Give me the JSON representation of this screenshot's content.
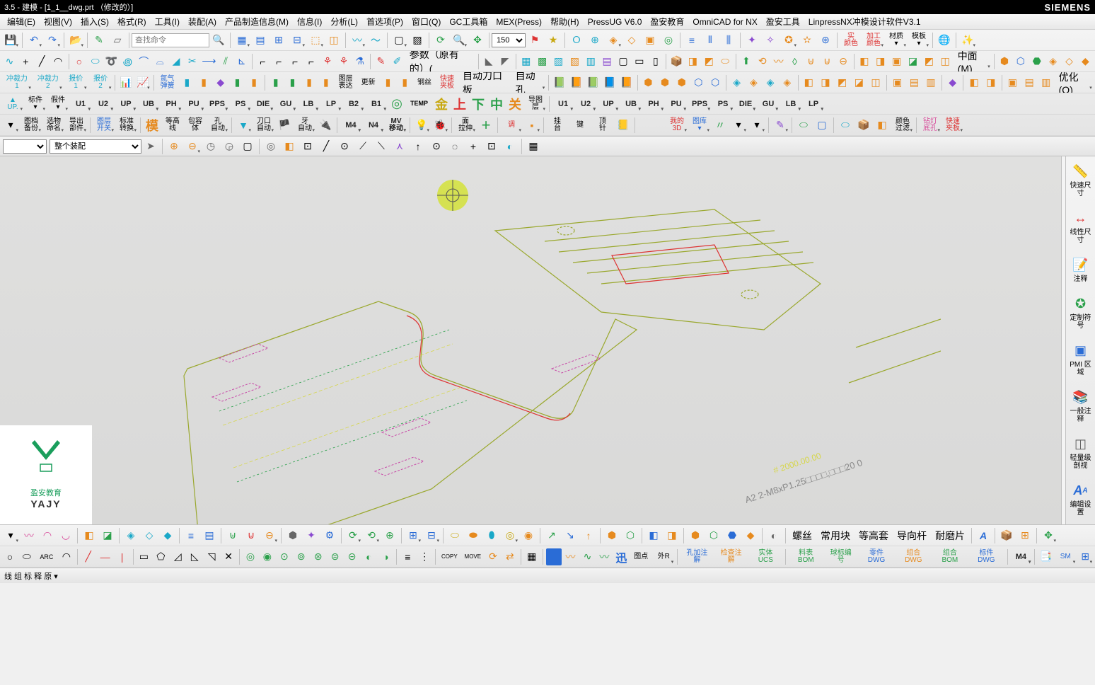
{
  "titlebar": {
    "left": "3.5 - 建模 - [1_1__dwg.prt （修改的）]",
    "right": "SIEMENS"
  },
  "menubar": [
    "编辑(E)",
    "视图(V)",
    "插入(S)",
    "格式(R)",
    "工具(I)",
    "装配(A)",
    "产品制造信息(M)",
    "信息(I)",
    "分析(L)",
    "首选项(P)",
    "窗口(Q)",
    "GC工具箱",
    "MEX(Press)",
    "帮助(H)",
    "PressUG V6.0",
    "盈安教育",
    "OmniCAD for NX",
    "盈安工具",
    "LinpressNX冲模设计软件V3.1"
  ],
  "row1": {
    "search_ph": "查找命令",
    "combo_val": "150"
  },
  "row2": {
    "param_label": "参数（原有的）(",
    "face_menu": "中面(M)"
  },
  "row3": {
    "u_items": [
      "U1",
      "U2",
      "UP",
      "UB",
      "PH",
      "PU",
      "PPS",
      "PS",
      "DIE",
      "GU",
      "LB",
      "LP",
      "B2",
      "B1"
    ],
    "right_items": [
      "U1",
      "U2",
      "UP",
      "UB",
      "PH",
      "PU",
      "PPS",
      "PS",
      "DIE",
      "GU",
      "LB",
      "LP"
    ],
    "misc": {
      "up": "UP.",
      "temp": "TEMP",
      "opt": "优化(Q)"
    }
  },
  "row4": {
    "auto_knife": "自动刀口板",
    "auto_hole": "自动孔",
    "gang": "钢丝"
  },
  "row5": {
    "m4": "M4",
    "n4": "N4",
    "mv": "MV"
  },
  "filter": {
    "combo1_val": "",
    "combo2_val": "整个装配"
  },
  "right_panel": [
    {
      "label": "快速尺寸",
      "name": "quick-dimension"
    },
    {
      "label": "线性尺寸",
      "name": "linear-dimension"
    },
    {
      "label": "注释",
      "name": "annotation"
    },
    {
      "label": "定制符号",
      "name": "custom-symbol"
    },
    {
      "label": "PMI 区域",
      "name": "pmi-region"
    },
    {
      "label": "一般注释",
      "name": "general-note"
    },
    {
      "label": "轻量级剖视",
      "name": "lightweight-section"
    },
    {
      "label": "编辑设置",
      "name": "edit-settings"
    }
  ],
  "logo": {
    "sub": "盈安教育",
    "sub2": "YAJY"
  },
  "canvas_text": {
    "annotation": "A2 2-M8xP1.25□□□□,□□□20 0",
    "yellow": "# 2000.00.00"
  },
  "bottom_row1_labels": [
    "螺丝",
    "常用块",
    "等高套",
    "导向杆",
    "耐磨片"
  ],
  "bottom_row2": {
    "m4": "M4",
    "sm": "SM",
    "copy": "COPY",
    "move": "MOVE",
    "pt": "图点",
    "ext": "外R",
    "hole": "孔加注解",
    "check": "检查注解",
    "solid": "实体UCS",
    "rough": "料表BOM",
    "ball": "球标编号",
    "part": "零件DWG",
    "group": "组合DWG",
    "origin": "组合BOM",
    "std": "标件DWG"
  },
  "statusbar": "线 组 标 释 原 ▾"
}
